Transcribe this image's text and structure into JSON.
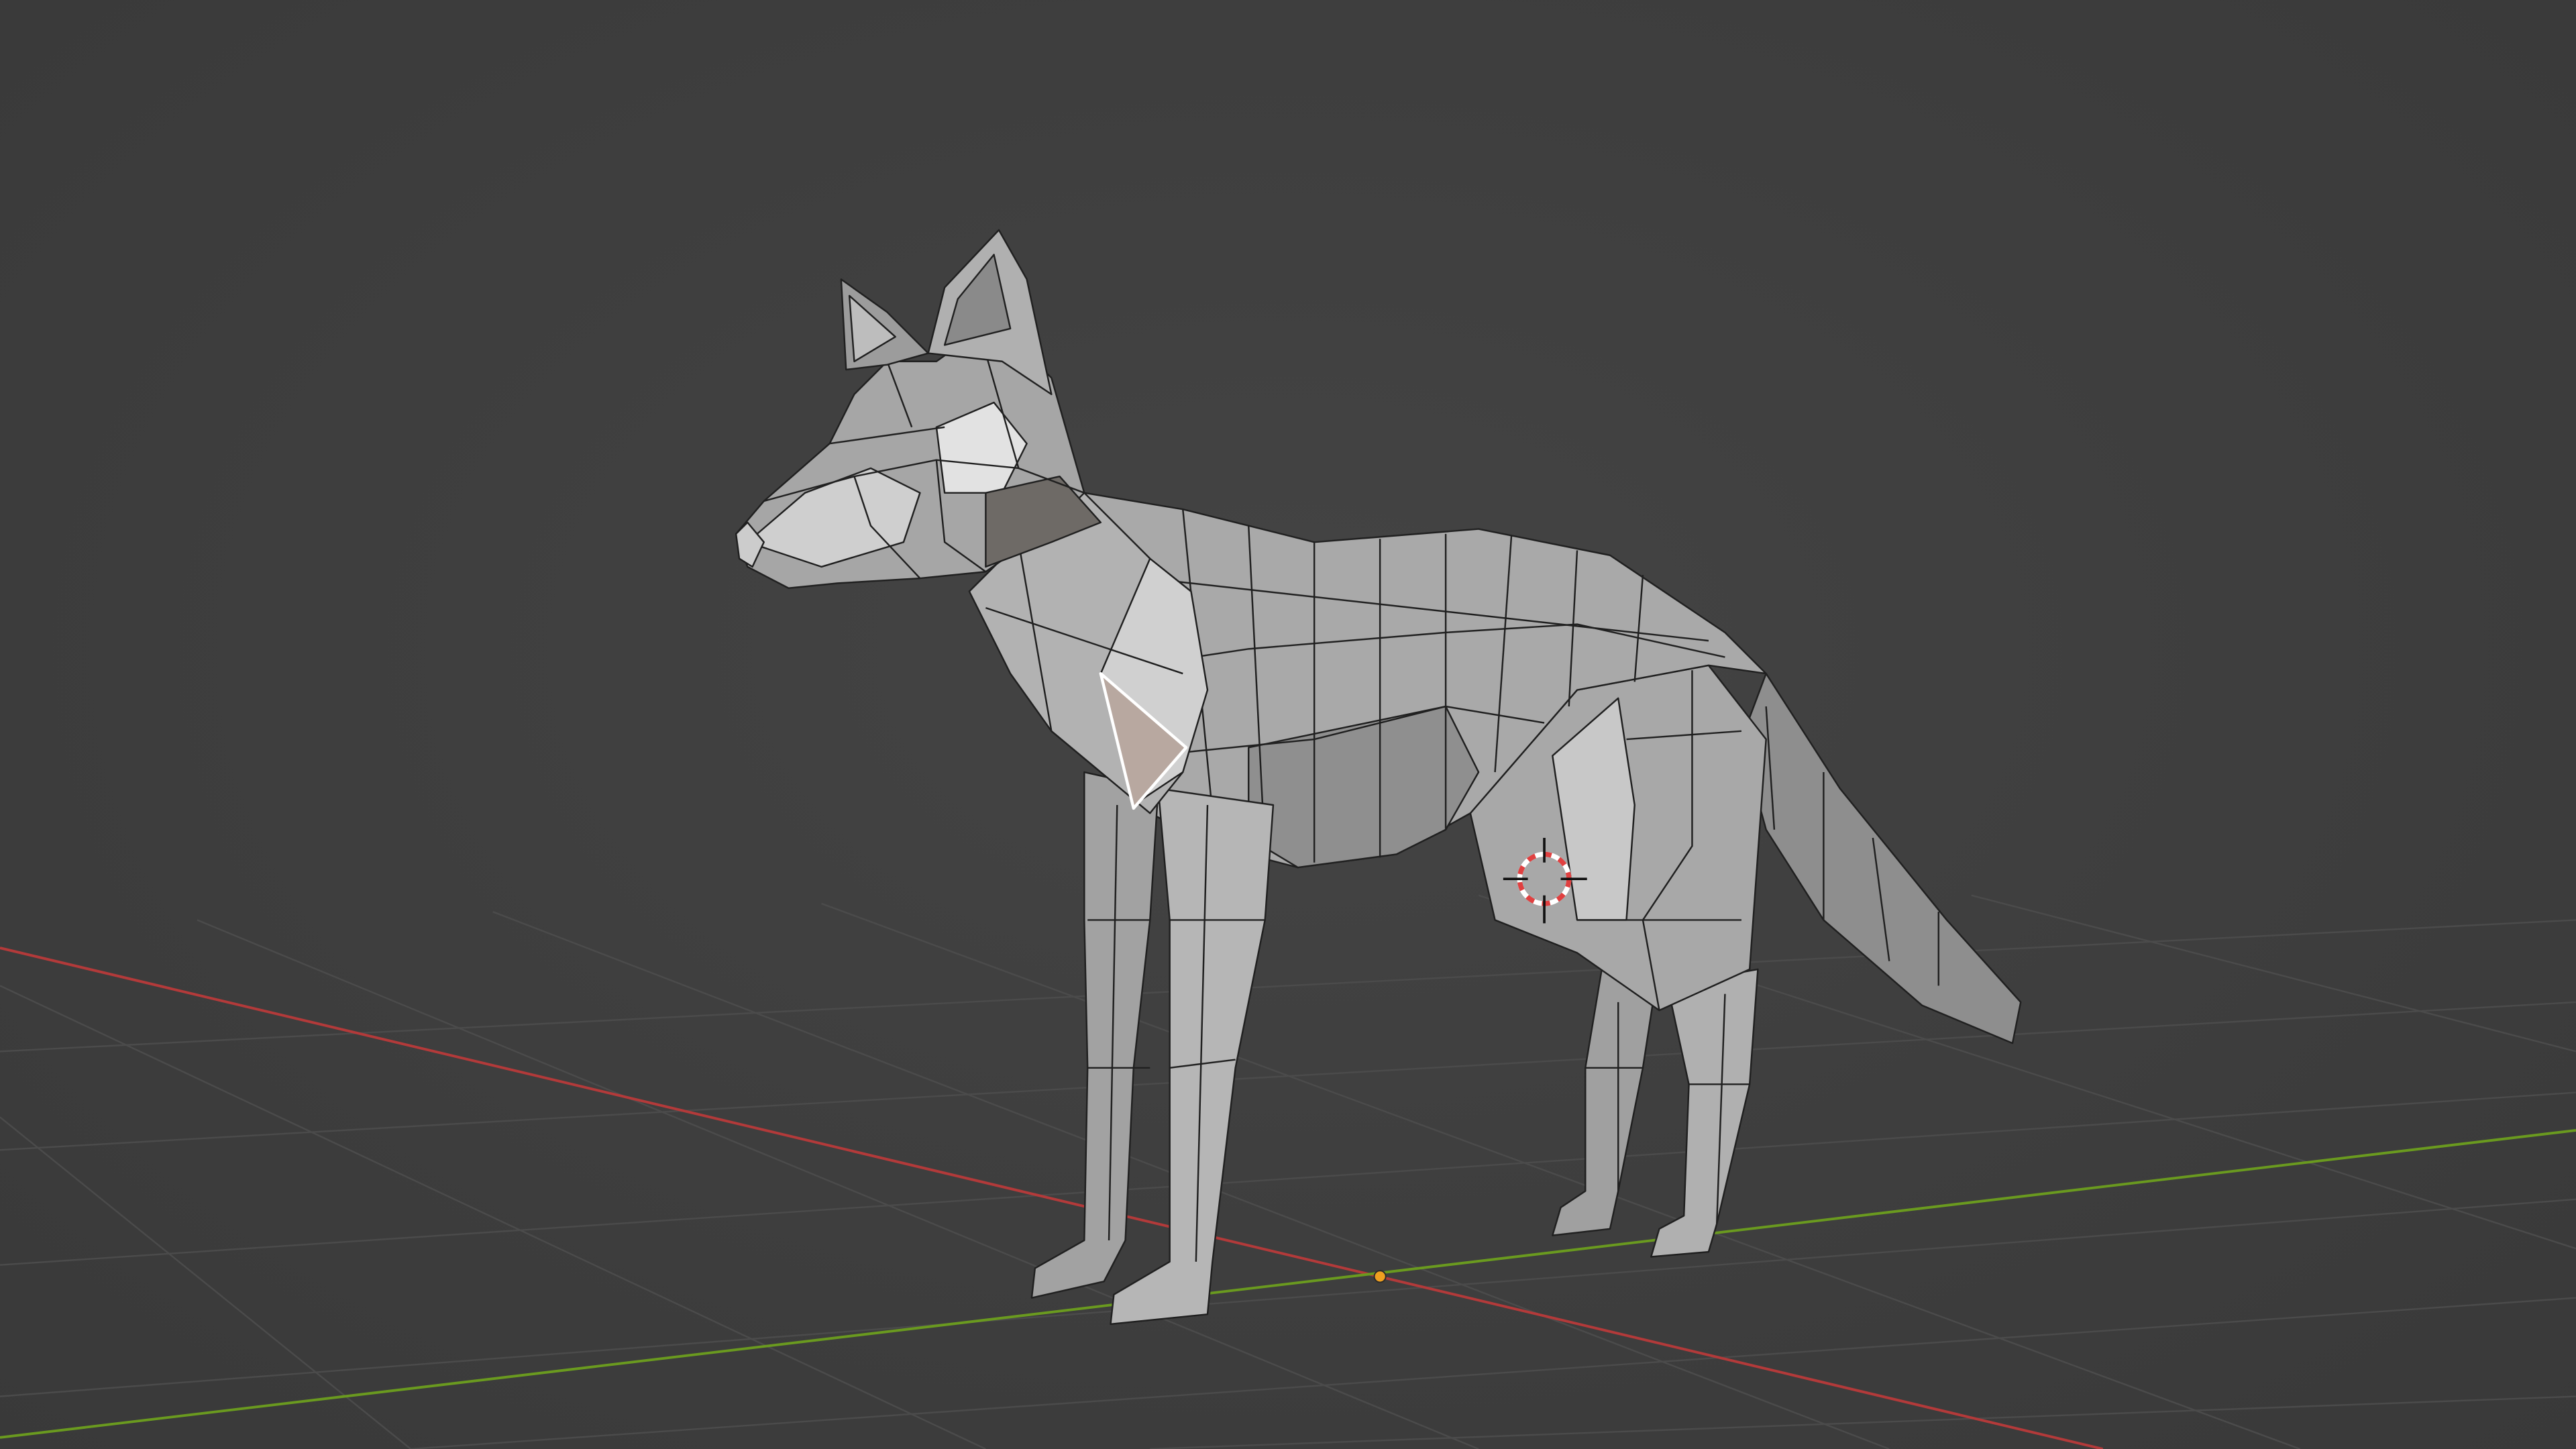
{
  "viewport": {
    "background_color": "#3d3d3d",
    "grid_color": "#4a4a4a",
    "x_axis_color": "#b33a3a",
    "y_axis_color": "#6a9a1f",
    "origin_color": "#f0a020",
    "mesh_face_color": "#9b9b9b",
    "mesh_edge_color": "#202020",
    "selected_face_color": "#b8a8a0",
    "selected_edge_color": "#ffffff",
    "cursor_ring_colors": [
      "#e04040",
      "#ffffff"
    ]
  },
  "scene": {
    "object_icon": "wolf-lowpoly-mesh",
    "cursor_icon": "3d-cursor-icon",
    "origin_icon": "object-origin-dot"
  }
}
